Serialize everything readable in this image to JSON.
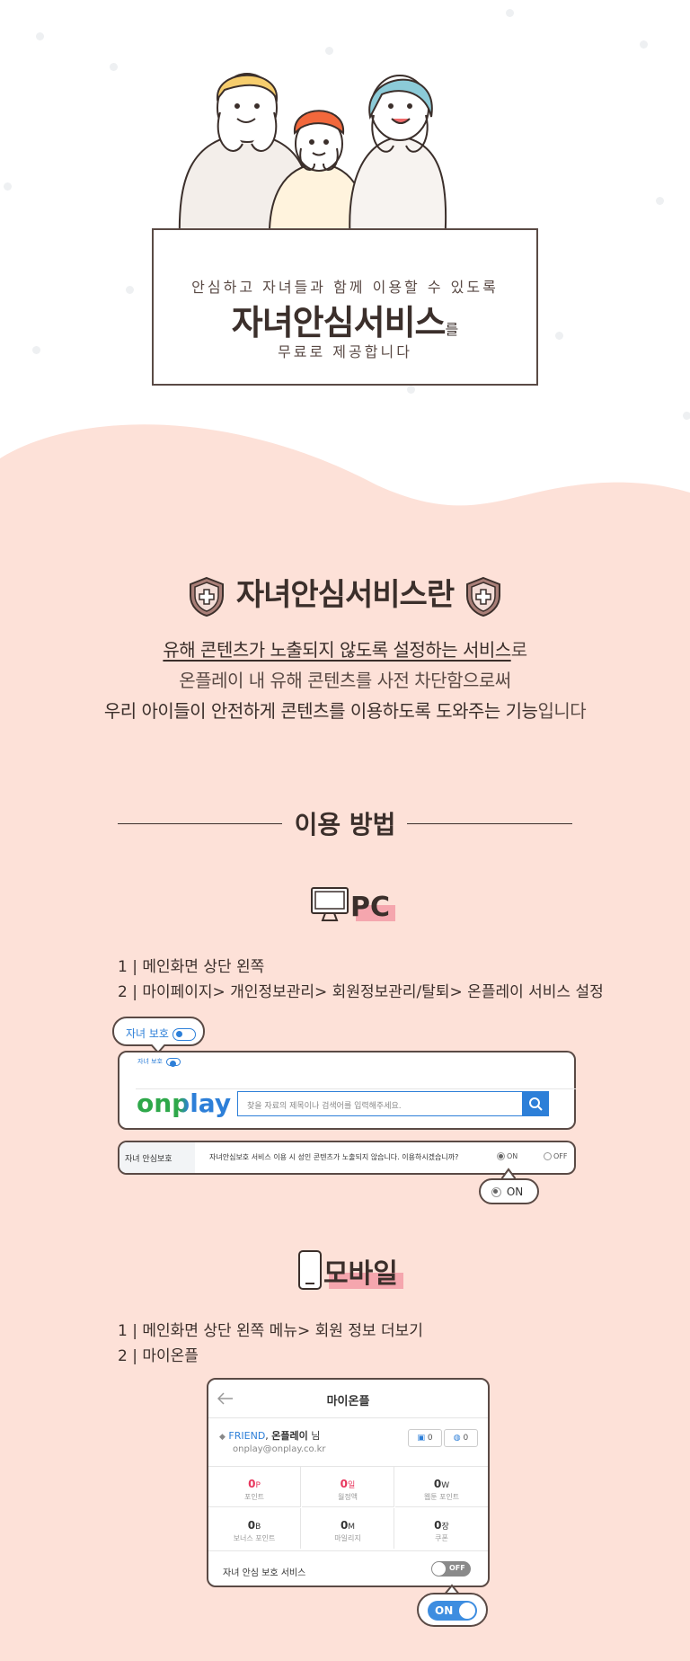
{
  "hero": {
    "line1": "안심하고 자녀들과 함께 이용할 수 있도록",
    "title": "자녀안심서비스",
    "title_suffix": "를",
    "line3": "무료로 제공합니다"
  },
  "intro": {
    "heading": "자녀안심서비스란",
    "line1_underlined": "유해 콘텐츠가 노출되지 않도록 설정하는 서비스",
    "line1_suffix": "로",
    "line2": "온플레이 내 유해 콘텐츠를 사전 차단함으로써",
    "line3_main": "우리 아이들이 안전하게 콘텐츠를 이용하도록 도와주는 기능",
    "line3_suffix": "입니다"
  },
  "how": {
    "heading": "이용 방법",
    "pc": {
      "badge": "PC",
      "steps": [
        "1 | 메인화면 상단 왼쪽",
        "2 | 마이페이지> 개인정보관리> 회원정보관리/탈퇴> 온플레이 서비스 설정"
      ],
      "bubble_label": "자녀 보호",
      "mini_label": "자녀 보호",
      "logo": "onplay",
      "search_placeholder": "찾을 자료의 제목이나 검색어를 입력해주세요.",
      "setting_label": "자녀 안심보호",
      "setting_desc": "자녀안심보호 서비스 이용 시 성인 콘텐츠가 노출되지 않습니다. 이용하시겠습니까?",
      "radio_on": "ON",
      "radio_off": "OFF",
      "bubble_on": "ON"
    },
    "mobile": {
      "badge": "모바일",
      "steps": [
        "1 | 메인화면 상단 왼쪽 메뉴> 회원 정보 더보기",
        "2 | 마이온플"
      ],
      "header_title": "마이온플",
      "grade": "FRIEND",
      "user_name": "온플레이",
      "user_suffix": "님",
      "email": "onplay@onplay.co.kr",
      "icon_count1": "0",
      "icon_count2": "0",
      "cells": [
        {
          "value": "0",
          "unit": "P",
          "label": "포인트",
          "red": true
        },
        {
          "value": "0",
          "unit": "일",
          "label": "월정액",
          "red": true
        },
        {
          "value": "0",
          "unit": "W",
          "label": "웹툰 포인트",
          "red": false
        },
        {
          "value": "0",
          "unit": "B",
          "label": "보너스 포인트",
          "red": false
        },
        {
          "value": "0",
          "unit": "M",
          "label": "마일리지",
          "red": false
        },
        {
          "value": "0",
          "unit": "장",
          "label": "쿠폰",
          "red": false
        }
      ],
      "service_label": "자녀 안심 보호 서비스",
      "toggle_off": "OFF",
      "toggle_on": "ON"
    }
  },
  "colors": {
    "pink_bg": "#fde1d8",
    "dark": "#3b2f2b",
    "accent_blue": "#2d7fd8",
    "badge_pink": "#f5a6ae"
  }
}
